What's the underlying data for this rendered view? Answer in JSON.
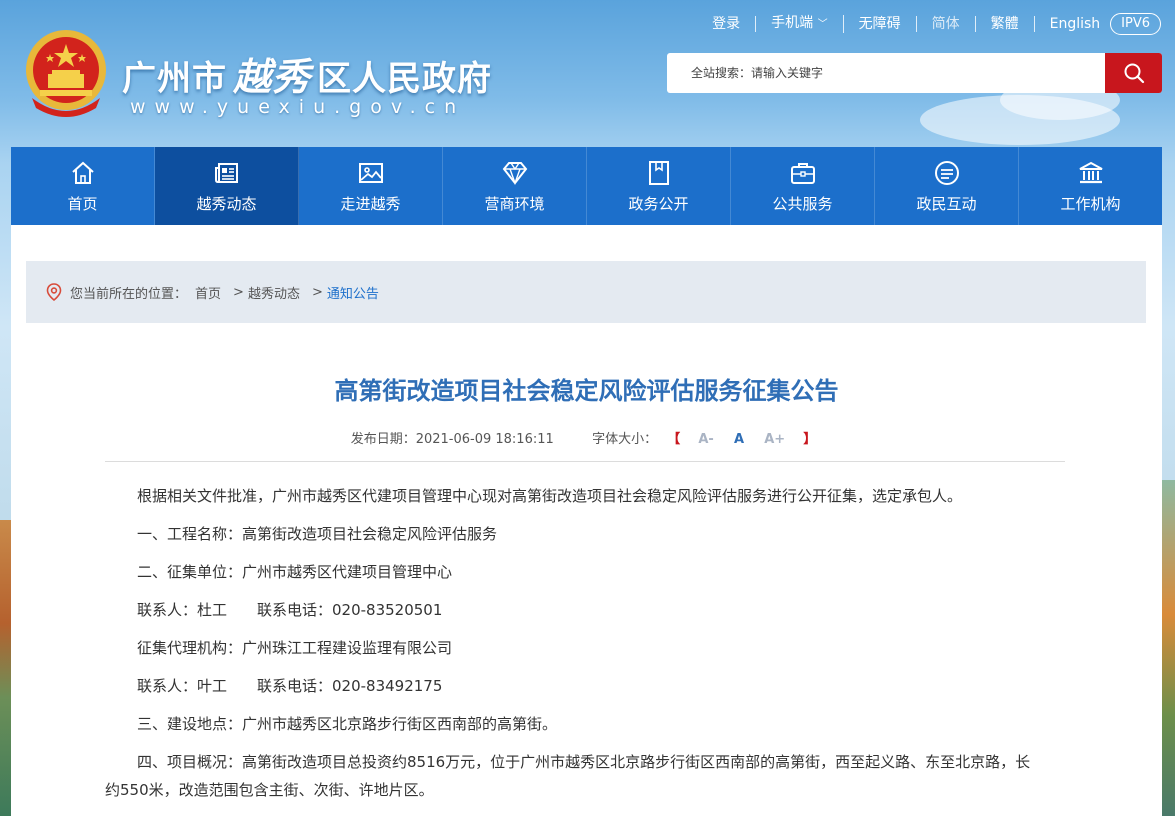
{
  "header": {
    "title_part1": "广州市",
    "title_part2": "越秀",
    "title_part3": "区人民政府",
    "url": "www.yuexiu.gov.cn"
  },
  "topnav": {
    "login": "登录",
    "mobile": "手机端",
    "accessibility": "无障碍",
    "simplified": "简体",
    "traditional": "繁體",
    "english": "English",
    "ipv6": "IPV6"
  },
  "search": {
    "placeholder": "全站搜索：请输入关键字"
  },
  "mainnav": {
    "items": [
      {
        "label": "首页",
        "icon": "home-icon"
      },
      {
        "label": "越秀动态",
        "icon": "news-icon"
      },
      {
        "label": "走进越秀",
        "icon": "picture-icon"
      },
      {
        "label": "营商环境",
        "icon": "diamond-icon"
      },
      {
        "label": "政务公开",
        "icon": "document-icon"
      },
      {
        "label": "公共服务",
        "icon": "briefcase-icon"
      },
      {
        "label": "政民互动",
        "icon": "chat-icon"
      },
      {
        "label": "工作机构",
        "icon": "building-icon"
      }
    ],
    "active_index": 1
  },
  "breadcrumb": {
    "prefix": "您当前所在的位置：",
    "home": "首页",
    "level1": "越秀动态",
    "current": "通知公告",
    "separator": ">"
  },
  "article": {
    "title": "高第街改造项目社会稳定风险评估服务征集公告",
    "date_label": "发布日期：",
    "date": "2021-06-09 18:16:11",
    "fontsize_label": "字体大小：",
    "bracket_open": "【",
    "bracket_close": "】",
    "font_small": "A-",
    "font_medium": "A",
    "font_large": "A+",
    "paragraphs": [
      "根据相关文件批准，广州市越秀区代建项目管理中心现对高第街改造项目社会稳定风险评估服务进行公开征集，选定承包人。",
      "一、工程名称：高第街改造项目社会稳定风险评估服务",
      "二、征集单位：广州市越秀区代建项目管理中心",
      "联系人：杜工　　联系电话：020-83520501",
      "征集代理机构：广州珠江工程建设监理有限公司",
      "联系人：叶工　　联系电话：020-83492175",
      "三、建设地点：广州市越秀区北京路步行街区西南部的高第街。",
      "四、项目概况：高第街改造项目总投资约8516万元，位于广州市越秀区北京路步行街区西南部的高第街，西至起义路、东至北京路，长约550米，改造范围包含主街、次街、许地片区。"
    ]
  },
  "colors": {
    "nav_blue": "#1c6fcb",
    "nav_active": "#0d4f9f",
    "title_blue": "#2f6eb6",
    "search_red": "#c8161d"
  }
}
